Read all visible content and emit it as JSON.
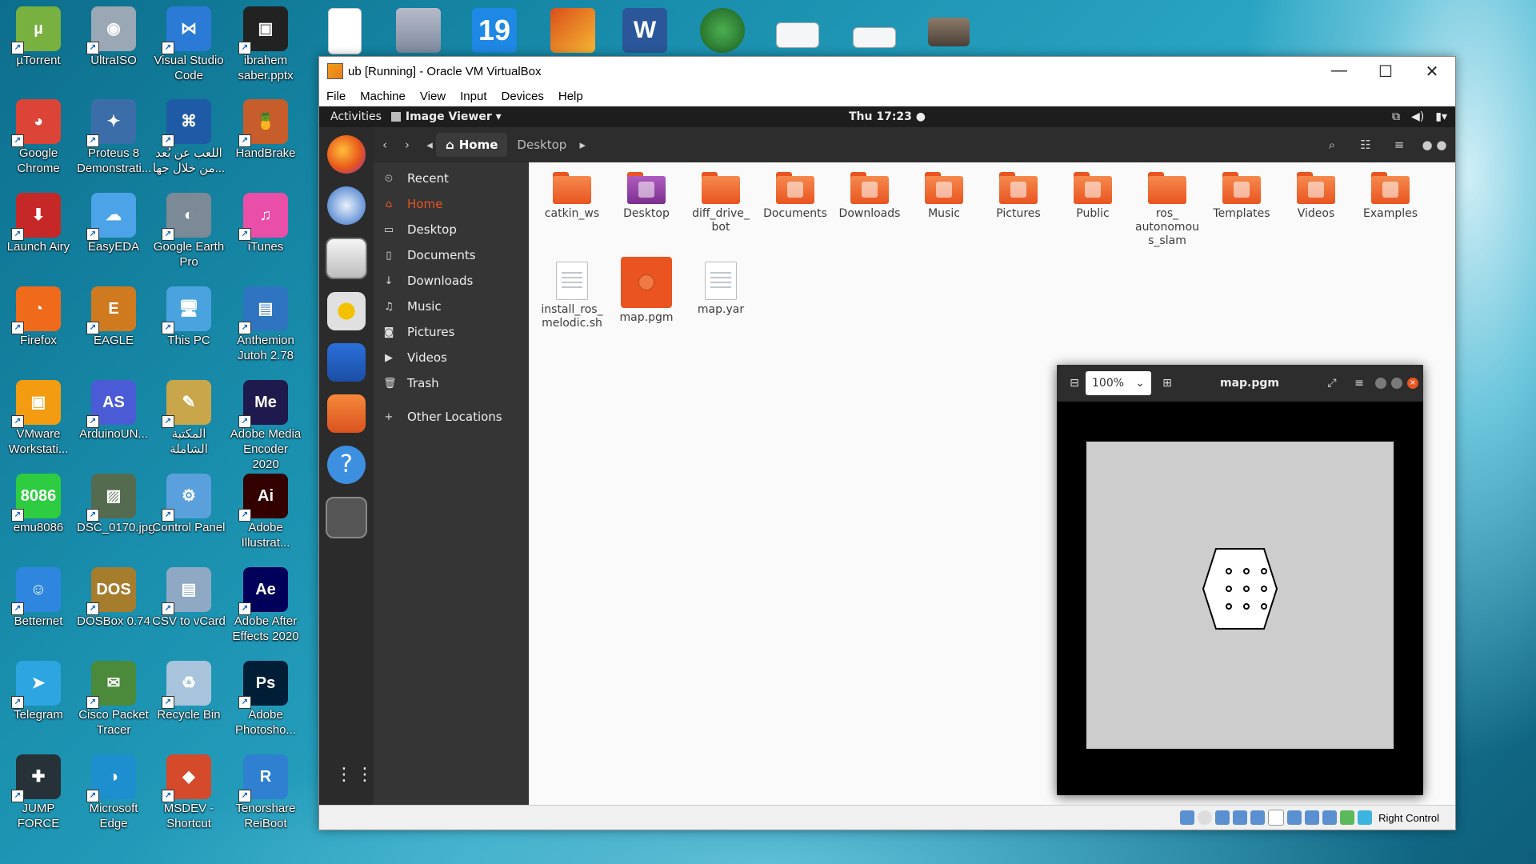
{
  "desktop": {
    "icons": [
      {
        "label": "µTorrent",
        "color": "#78b13f"
      },
      {
        "label": "UltraISO",
        "color": "#9aa7b5"
      },
      {
        "label": "Visual Studio Code",
        "color": "#2a7ad6"
      },
      {
        "label": "ibrahem saber.pptx",
        "color": "#222222"
      },
      {
        "label": "Google Chrome",
        "color": "#db4437"
      },
      {
        "label": "Proteus 8 Demonstrati...",
        "color": "#3b6ea8"
      },
      {
        "label": "اللعب عن بُعد من خلال جها...",
        "color": "#1f5aa6"
      },
      {
        "label": "HandBrake",
        "color": "#c65d2a"
      },
      {
        "label": "Launch Airy",
        "color": "#c62828"
      },
      {
        "label": "EasyEDA",
        "color": "#4da3e8"
      },
      {
        "label": "Google Earth Pro",
        "color": "#7b8a96"
      },
      {
        "label": "iTunes",
        "color": "#e94ea8"
      },
      {
        "label": "Firefox",
        "color": "#f06a1c"
      },
      {
        "label": "EAGLE",
        "color": "#cf7a1e"
      },
      {
        "label": "This PC",
        "color": "#4aa3df"
      },
      {
        "label": "Anthemion Jutoh 2.78",
        "color": "#2f74c0"
      },
      {
        "label": "VMware Workstati...",
        "color": "#f39c12"
      },
      {
        "label": "ArduinoUN...",
        "color": "#4b5bd6"
      },
      {
        "label": "المكتبة الشاملة",
        "color": "#c9a64a"
      },
      {
        "label": "Adobe Media Encoder 2020",
        "color": "#1f1a4d"
      },
      {
        "label": "emu8086",
        "color": "#2ecc40"
      },
      {
        "label": "DSC_0170.jpg",
        "color": "#556b4f"
      },
      {
        "label": "Control Panel",
        "color": "#5aa0dc"
      },
      {
        "label": "Adobe Illustrat...",
        "color": "#330000"
      },
      {
        "label": "Betternet",
        "color": "#2e86de"
      },
      {
        "label": "DOSBox 0.74",
        "color": "#a67c2d"
      },
      {
        "label": "CSV to vCard",
        "color": "#8fa9c4"
      },
      {
        "label": "Adobe After Effects 2020",
        "color": "#00005b"
      },
      {
        "label": "Telegram",
        "color": "#2ca5e0"
      },
      {
        "label": "Cisco Packet Tracer",
        "color": "#4a8a3a"
      },
      {
        "label": "Recycle Bin",
        "color": "#a7c4dc"
      },
      {
        "label": "Adobe Photosho...",
        "color": "#001e36"
      },
      {
        "label": "JUMP FORCE",
        "color": "#263238"
      },
      {
        "label": "Microsoft Edge",
        "color": "#1d8fcf"
      },
      {
        "label": "MSDEV - Shortcut",
        "color": "#d44a2a"
      },
      {
        "label": "Tenorshare ReiBoot",
        "color": "#2f80d0"
      }
    ],
    "icon_glyphs": [
      "µ",
      "◉",
      "⋈",
      "▣",
      "◕",
      "✦",
      "⌘",
      "🍍",
      "⬇",
      "☁",
      "◐",
      "♫",
      "◔",
      "E",
      "🖥",
      "▤",
      "▣",
      "AS",
      "✎",
      "Me",
      "8086",
      "▨",
      "⚙",
      "Ai",
      "☺",
      "DOS",
      "▤",
      "Ae",
      "➤",
      "✉",
      "♻",
      "Ps",
      "✚",
      "◑",
      "◆",
      "R"
    ]
  },
  "vbox": {
    "title": "ub [Running] - Oracle VM VirtualBox",
    "menu": [
      "File",
      "Machine",
      "View",
      "Input",
      "Devices",
      "Help"
    ],
    "status_right": "Right Control"
  },
  "ubuntu": {
    "activities": "Activities",
    "app_name": "Image Viewer ▾",
    "clock": "Thu 17:23 ●"
  },
  "nautilus": {
    "crumbs": {
      "home": "Home",
      "desktop": "Desktop"
    },
    "sidebar": [
      {
        "icon": "⏲",
        "label": "Recent"
      },
      {
        "icon": "⌂",
        "label": "Home"
      },
      {
        "icon": "▭",
        "label": "Desktop"
      },
      {
        "icon": "▯",
        "label": "Documents"
      },
      {
        "icon": "↓",
        "label": "Downloads"
      },
      {
        "icon": "♫",
        "label": "Music"
      },
      {
        "icon": "◙",
        "label": "Pictures"
      },
      {
        "icon": "▶",
        "label": "Videos"
      },
      {
        "icon": "🗑",
        "label": "Trash"
      },
      {
        "icon": "+",
        "label": "Other Locations"
      }
    ],
    "files_row1": [
      "catkin_ws",
      "Desktop",
      "diff_drive_\nbot",
      "Documents",
      "Downloads",
      "Music",
      "Pictures",
      "Public",
      "ros_\nautonomou\ns_slam",
      "Templates",
      "Videos",
      "Examples"
    ],
    "files_row2": [
      "install_ros_\nmelodic.sh",
      "map.pgm",
      "map.yar"
    ]
  },
  "viewer": {
    "zoom": "100%",
    "title": "map.pgm"
  }
}
